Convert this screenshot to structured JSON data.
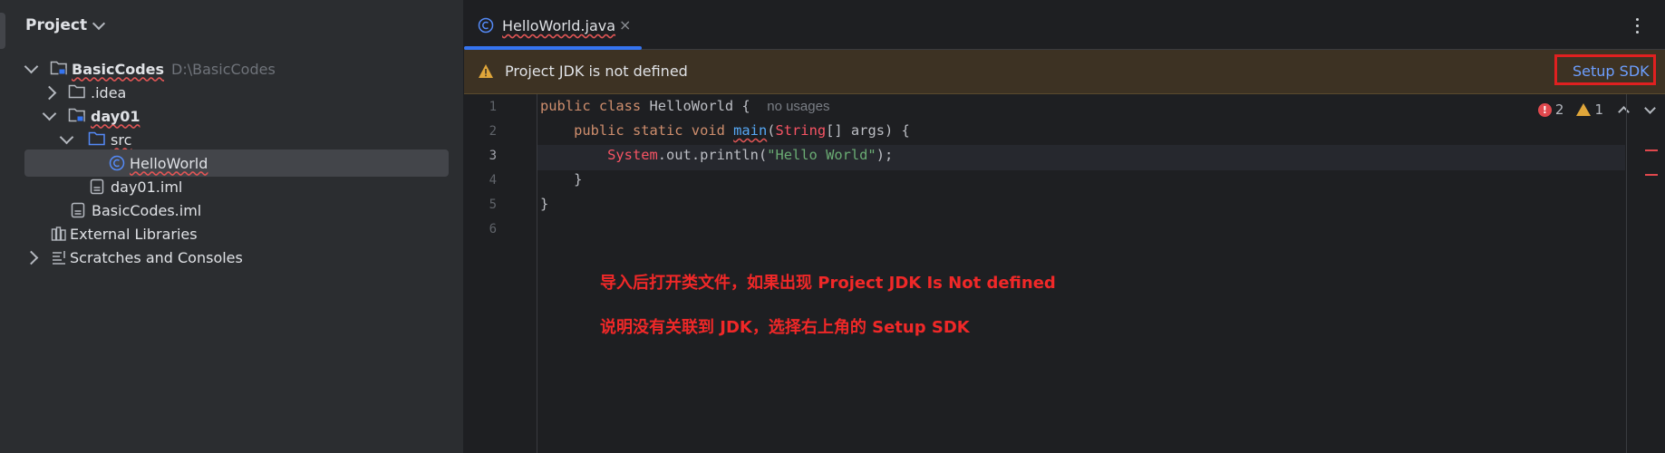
{
  "project_panel": {
    "title": "Project",
    "tree": [
      {
        "label": "BasicCodes",
        "path": "D:\\BasicCodes",
        "type": "module-folder",
        "expanded": true
      },
      {
        "label": ".idea",
        "type": "folder",
        "expanded": false
      },
      {
        "label": "day01",
        "type": "module-folder",
        "expanded": true
      },
      {
        "label": "src",
        "type": "source-folder",
        "expanded": true
      },
      {
        "label": "HelloWorld",
        "type": "java-class",
        "selected": true
      },
      {
        "label": "day01.iml",
        "type": "iml-file"
      },
      {
        "label": "BasicCodes.iml",
        "type": "iml-file"
      },
      {
        "label": "External Libraries",
        "type": "libraries"
      },
      {
        "label": "Scratches and Consoles",
        "type": "scratches",
        "expanded": false
      }
    ]
  },
  "editor": {
    "tab": {
      "title": "HelloWorld.java",
      "close": "×"
    },
    "banner": {
      "message": "Project JDK is not defined",
      "action": "Setup SDK"
    },
    "line_numbers": [
      "1",
      "2",
      "3",
      "4",
      "5",
      "6"
    ],
    "active_line": 3,
    "code": {
      "l1": {
        "kw": "public class ",
        "name": "HelloWorld",
        "rest": " {",
        "hint": "no usages"
      },
      "l2": {
        "kw": "public static void ",
        "fn": "main",
        "p1": "(",
        "cls": "String",
        "rest": "[] args) {"
      },
      "l3": {
        "cls": "System",
        "mid": ".out.println(",
        "str": "\"Hello World\"",
        "end": ");"
      },
      "l4": {
        "text": "}"
      },
      "l5": {
        "text": "}"
      }
    },
    "inspections": {
      "errors": "2",
      "warnings": "1"
    }
  },
  "annotation": {
    "line1": "导入后打开类文件，如果出现  Project JDK Is Not defined",
    "line2": "说明没有关联到 JDK，选择右上角的 Setup SDK",
    "color": "#f02828"
  },
  "colors": {
    "accent": "#3574f0",
    "link": "#6d9fff",
    "error": "#e0484d",
    "warning": "#e0a63a"
  }
}
